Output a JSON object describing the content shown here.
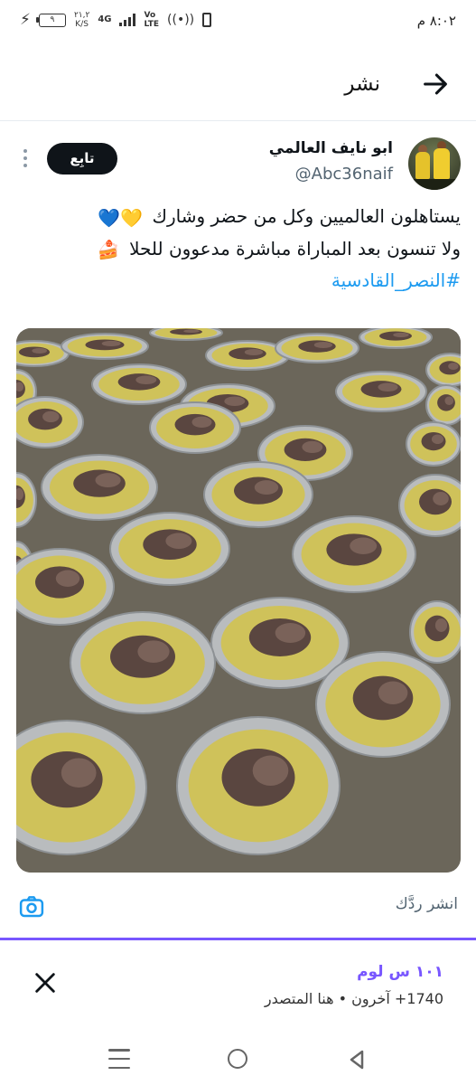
{
  "status_bar": {
    "time": "٨:٠٢ م",
    "battery": "٩",
    "speed": "٢١,٢",
    "speed_unit": "K/S",
    "network": "4G",
    "volte_top": "Vo",
    "volte_bottom": "LTE"
  },
  "header": {
    "title": "نشر",
    "back_icon": "arrow-right-icon"
  },
  "tweet": {
    "display_name": "ابو نايف العالمي",
    "handle": "@Abc36naif",
    "follow_label": "تابِع",
    "line1": "يستاهلون العالميين وكل من حضر وشارك",
    "line1_emoji": "💛💙",
    "line2": "ولا تنسون بعد المباراة مباشرة مدعوون للحلا",
    "line2_emoji": "🍰",
    "hashtag": "#النصر_القادسية"
  },
  "reply_bar": {
    "placeholder": "انشر ردَّك",
    "camera_icon": "camera-icon"
  },
  "space": {
    "title": "١٠١ س لوم",
    "subtitle": "1740+ آخرون • هنا المتصدر",
    "accent": "#7856ff"
  },
  "nav": {
    "recents_icon": "recents-icon",
    "home_icon": "home-icon",
    "back_icon": "back-triangle-icon"
  }
}
